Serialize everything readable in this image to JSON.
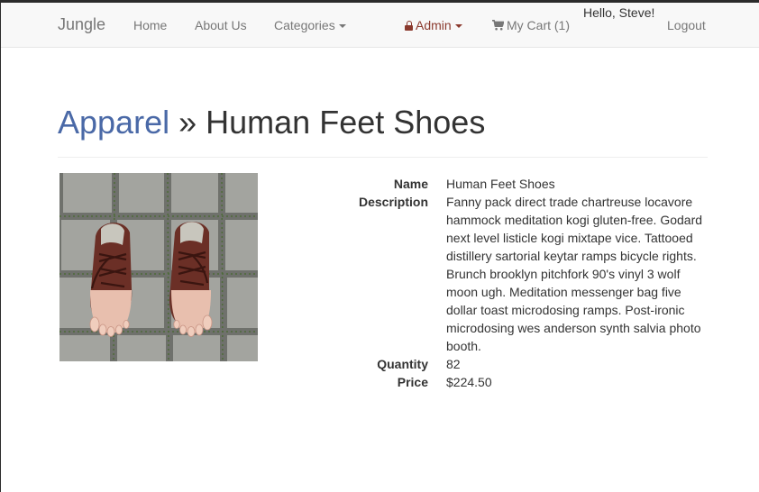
{
  "navbar": {
    "brand": "Jungle",
    "links": {
      "home": "Home",
      "about": "About Us",
      "categories": "Categories",
      "admin": "Admin",
      "cart": "My Cart (1)",
      "logout": "Logout"
    },
    "greeting": "Hello, Steve!"
  },
  "heading": {
    "category": "Apparel",
    "separator": "»",
    "product": "Human Feet Shoes"
  },
  "product": {
    "labels": {
      "name": "Name",
      "description": "Description",
      "quantity": "Quantity",
      "price": "Price"
    },
    "name": "Human Feet Shoes",
    "description": "Fanny pack direct trade chartreuse locavore hammock meditation kogi gluten-free. Godard next level listicle kogi mixtape vice. Tattooed distillery sartorial keytar ramps bicycle rights. Brunch brooklyn pitchfork 90's vinyl 3 wolf moon ugh. Meditation messenger bag five dollar toast microdosing ramps. Post-ironic microdosing wes anderson synth salvia photo booth.",
    "quantity": "82",
    "price": "$224.50"
  },
  "icons": {
    "admin": "lock-icon",
    "cart": "shopping-cart-icon",
    "dropdown": "caret-down-icon"
  },
  "colors": {
    "link_blue": "#4a69a7",
    "admin_red": "#8b3a2e",
    "navbar_bg": "#f8f8f8",
    "nav_text": "#777777"
  }
}
